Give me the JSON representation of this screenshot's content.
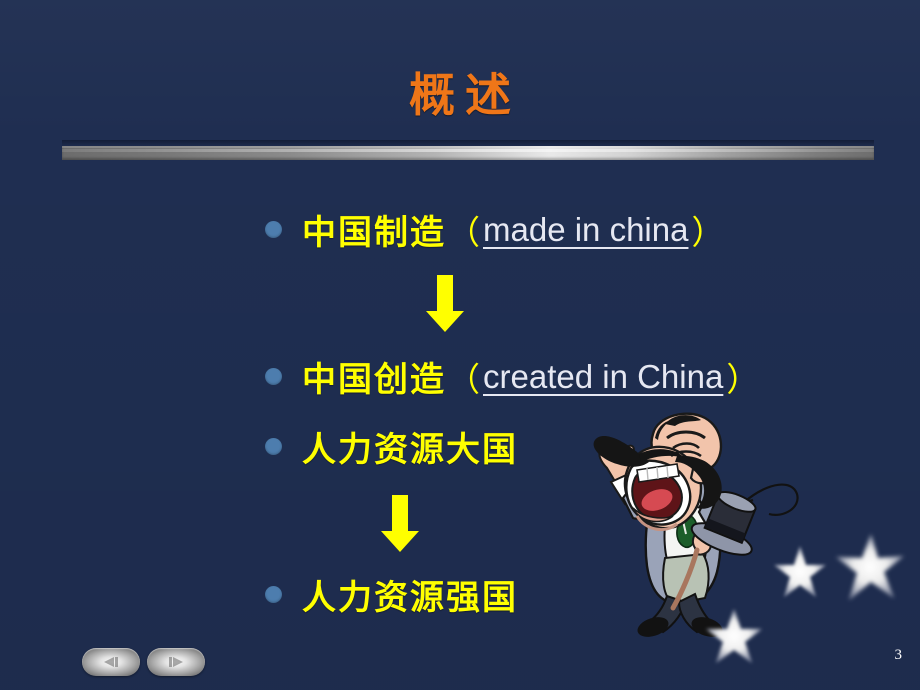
{
  "slide": {
    "title": "概述",
    "background_color": "#1f2e51",
    "title_color": "#ef7618",
    "bullet_color": "#4d7dae",
    "chinese_text_color": "#ffff00",
    "english_text_color": "#e6e8f2",
    "arrow_color": "#ffff00",
    "page_number": "3"
  },
  "bullets": [
    {
      "chinese": "中国制造",
      "open_paren": "（",
      "english": "made in china",
      "close_paren": "）"
    },
    {
      "chinese": "中国创造",
      "open_paren": "（",
      "english": "created in China",
      "close_paren": "）"
    },
    {
      "chinese": "人力资源大国",
      "open_paren": "",
      "english": "",
      "close_paren": ""
    },
    {
      "chinese": "人力资源强国",
      "open_paren": "",
      "english": "",
      "close_paren": ""
    }
  ],
  "arrows": [
    {
      "name": "down-arrow-1",
      "direction": "down"
    },
    {
      "name": "down-arrow-2",
      "direction": "down"
    }
  ],
  "decorations": {
    "cartoon": "singing-performer-with-top-hat-and-cane",
    "stars": [
      "star-1",
      "star-2",
      "star-3"
    ]
  },
  "navigation": {
    "prev_label": "◀",
    "next_label": "▶"
  }
}
